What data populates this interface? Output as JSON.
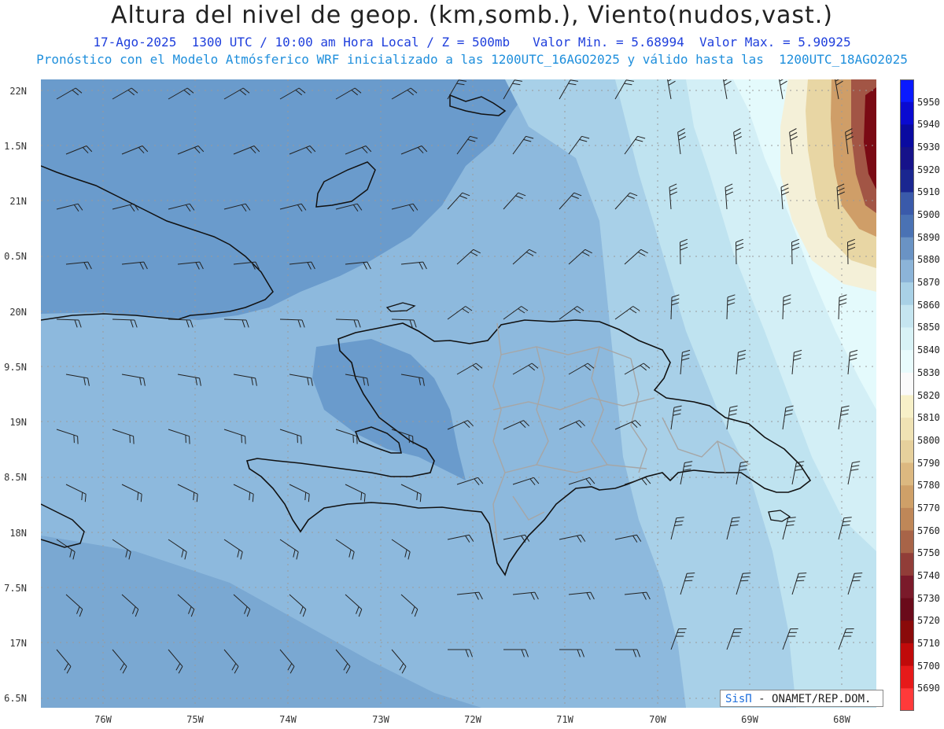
{
  "title": "Altura del nivel de geop. (km,somb.), Viento(nudos,vast.)",
  "subtitle1": "17-Ago-2025  1300 UTC / 10:00 am Hora Local / Z = 500mb   Valor Min. = 5.68994  Valor Max. = 5.90925",
  "subtitle2": "Pronóstico con el Modelo Atmósferico WRF inicializado a las 1200UTC_16AGO2025 y válido hasta las  1200UTC_18AGO2025",
  "credit": {
    "brand": "SisΠ",
    "text": "- ONAMET/REP.DOM."
  },
  "axes": {
    "y_ticks": [
      "22N",
      "1.5N",
      "21N",
      "0.5N",
      "20N",
      "9.5N",
      "19N",
      "8.5N",
      "18N",
      "7.5N",
      "17N",
      "6.5N"
    ],
    "x_ticks": [
      "76W",
      "75W",
      "74W",
      "73W",
      "72W",
      "71W",
      "70W",
      "69W",
      "68W"
    ]
  },
  "colorbar": {
    "levels": [
      "5950",
      "5940",
      "5930",
      "5920",
      "5910",
      "5900",
      "5890",
      "5880",
      "5870",
      "5860",
      "5850",
      "5840",
      "5830",
      "5820",
      "5810",
      "5800",
      "5790",
      "5780",
      "5770",
      "5760",
      "5750",
      "5740",
      "5730",
      "5720",
      "5710",
      "5700",
      "5690"
    ],
    "colors": [
      "#0a1aff",
      "#0a0ad0",
      "#0a0aa0",
      "#16128a",
      "#1a2690",
      "#3a5aaa",
      "#4a72b4",
      "#6a93c4",
      "#8cb4d8",
      "#a9d1e6",
      "#c5e5f0",
      "#d8f2f6",
      "#e8fbfc",
      "#fafafa",
      "#f7f0c8",
      "#efe2b4",
      "#e6d09c",
      "#dcb880",
      "#cfa068",
      "#bf8758",
      "#a86448",
      "#913d38",
      "#7a1a2a",
      "#6a0a1a",
      "#8a0a0a",
      "#c00a0a",
      "#e61a1a",
      "#ff3a3a"
    ]
  }
}
